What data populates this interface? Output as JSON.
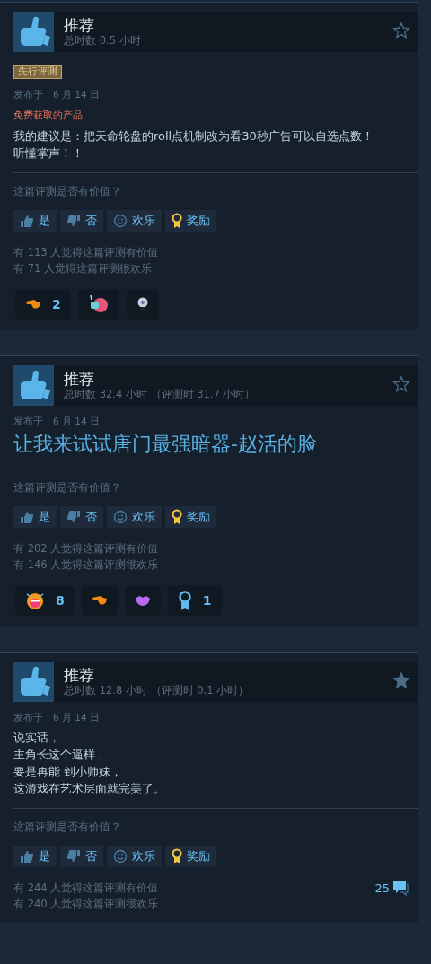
{
  "reviews": [
    {
      "verdict": "推荐",
      "hours": "总时数 0.5 小时",
      "starred": false,
      "badge": "先行评测",
      "posted": "发布于：6 月 14 日",
      "source": "免费获取的产品",
      "body": {
        "kind": "text",
        "lines": [
          "我的建议是：把天命轮盘的roll点机制改为看30秒广告可以自选点数！",
          "听懂掌声！！"
        ]
      },
      "question": "这篇评测是否有价值？",
      "buttons": [
        {
          "kind": "yes",
          "label": "是"
        },
        {
          "kind": "no",
          "label": "否"
        },
        {
          "kind": "funny",
          "label": "欢乐"
        },
        {
          "kind": "award",
          "label": "奖励"
        }
      ],
      "stats": [
        "有 113 人觉得这篇评测有价值",
        "有 71 人觉得这篇评测很欢乐"
      ],
      "awards": [
        {
          "kind": "hand",
          "count": "2"
        },
        {
          "kind": "brain"
        },
        {
          "kind": "bulb"
        }
      ]
    },
    {
      "verdict": "推荐",
      "hours": "总时数 32.4 小时 （评测时 31.7 小时）",
      "starred": false,
      "posted": "发布于：6 月 14 日",
      "body": {
        "kind": "heading",
        "lines": [
          "让我来试试唐门最强暗器-赵活的脸"
        ]
      },
      "question": "这篇评测是否有价值？",
      "buttons": [
        {
          "kind": "yes",
          "label": "是"
        },
        {
          "kind": "no",
          "label": "否"
        },
        {
          "kind": "funny",
          "label": "欢乐"
        },
        {
          "kind": "award",
          "label": "奖励"
        }
      ],
      "stats": [
        "有 202 人觉得这篇评测有价值",
        "有 146 人觉得这篇评测很欢乐"
      ],
      "awards": [
        {
          "kind": "laugh",
          "count": "8"
        },
        {
          "kind": "hand"
        },
        {
          "kind": "lips"
        },
        {
          "kind": "ribbon",
          "count": "1"
        }
      ]
    },
    {
      "verdict": "推荐",
      "hours": "总时数 12.8 小时 （评测时 0.1 小时）",
      "starred": true,
      "posted": "发布于：6 月 14 日",
      "body": {
        "kind": "text",
        "lines": [
          "说实话，",
          "主角长这个逼样，",
          "要是再能 到小师妹，",
          "这游戏在艺术层面就完美了。"
        ]
      },
      "question": "这篇评测是否有价值？",
      "buttons": [
        {
          "kind": "yes",
          "label": "是"
        },
        {
          "kind": "no",
          "label": "否"
        },
        {
          "kind": "funny",
          "label": "欢乐"
        },
        {
          "kind": "award",
          "label": "奖励"
        }
      ],
      "stats": [
        "有 244 人觉得这篇评测有价值",
        "有 240 人觉得这篇评测很欢乐"
      ],
      "comments": "25"
    }
  ]
}
